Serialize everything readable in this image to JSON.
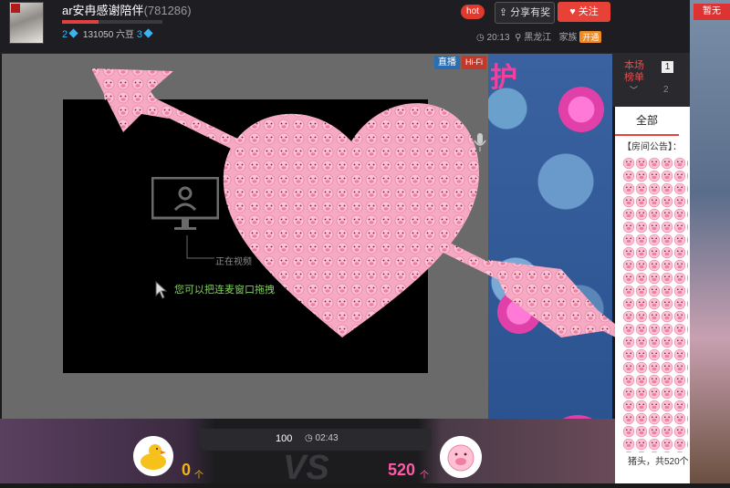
{
  "header": {
    "room_title": "ar安冉感谢陪伴",
    "room_id": "(781286)",
    "level_left": "2",
    "beans": "131050 六豆",
    "level_right": "3",
    "hot_label": "hot",
    "share_label": "分享有奖",
    "follow_label": "关注",
    "time": "20:13",
    "location": "黑龙江",
    "family_label": "家族",
    "family_badge": "开通",
    "top_right_tag": "暂无"
  },
  "video": {
    "live_tag": "直播",
    "hifi_tag": "Hi-Fi",
    "waiting_text": "正在视频",
    "drag_hint": "您可以把连麦窗口拖拽",
    "overlay_text": "护"
  },
  "ranking": {
    "title": "本场榜单",
    "rank1": "1",
    "rank2": "2"
  },
  "chat": {
    "tab_all": "全部",
    "notice": "【房间公告】：",
    "last_message": "猪头，共520个，"
  },
  "pk": {
    "score": "100",
    "timer": "02:43",
    "left_count": "0",
    "left_unit": "个",
    "right_count": "520",
    "right_unit": "个",
    "vs": "VS"
  },
  "colors": {
    "accent": "#e84138",
    "pig_pink": "#f7a6c4",
    "live_blue": "#2b6fb3",
    "drag_green": "#7fd35a",
    "left_gold": "#f2b318",
    "right_pink": "#ff5aa6"
  }
}
